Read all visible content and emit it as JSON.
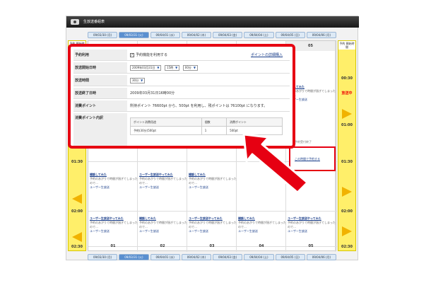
{
  "window": {
    "title": "生放送番組表"
  },
  "dates_top": [
    "09/03/30 (月)",
    "09/03/31 (火)",
    "09/04/01 (水)",
    "09/04/02 (木)",
    "09/04/03 (金)",
    "09/04/04 (土)",
    "09/04/05 (日)",
    "09/04/06 (月)"
  ],
  "dates_bottom": [
    "09/03/30 (月)",
    "09/03/31 (火)",
    "09/04/01 (水)",
    "09/04/02 (木)",
    "09/04/03 (金)",
    "09/04/04 (土)",
    "09/04/05 (日)",
    "09/04/06 (月)"
  ],
  "active_date_index": 1,
  "time_header_top": "予約\n開始時間",
  "time_header_bottom": "予約\n開始時間",
  "times_left": [
    "01:30",
    "02:00",
    "02:30"
  ],
  "times_right": [
    "00:30",
    "01:00",
    "01:30",
    "02:00",
    "02:30"
  ],
  "on_air": "放送中",
  "columns": [
    "01",
    "02",
    "03",
    "04",
    "05"
  ],
  "column_label_topright": "05",
  "prog_title": "ユーザー生放送やってみた",
  "prog_title_alt": "雑談してみた",
  "prog_sub": "予約のあがりで時間が過ぎてしまったので…",
  "prog_link": "ユーザー生放送",
  "prog_dur": "予約可",
  "free_slot": "この時間で予約する",
  "prog_done": "予約受付終了",
  "popup": {
    "reserve_label": "予約利用",
    "reserve_checkbox": "予約機能を利用する",
    "points_link": "ポイントの詳細購入",
    "start_label": "放送開始日時",
    "start_date": "2009年03月31日",
    "start_hour": "15時",
    "start_min": "00分",
    "duration_label": "放送時間",
    "duration": "30分",
    "end_label": "放送終了日時",
    "end_value": "2009年03月31日16時00分",
    "consume_label": "消費ポイント",
    "consume_value": "所持ポイント 76600pt から、500pt を利用し、残ポイントは 76100pt になります。",
    "detail_label": "消費ポイント内訳",
    "table_headers": [
      "ポイント消費用途",
      "個数",
      "消費ポイント"
    ],
    "table_row": [
      "予約(30分)500pt",
      "1",
      "500pt"
    ]
  }
}
